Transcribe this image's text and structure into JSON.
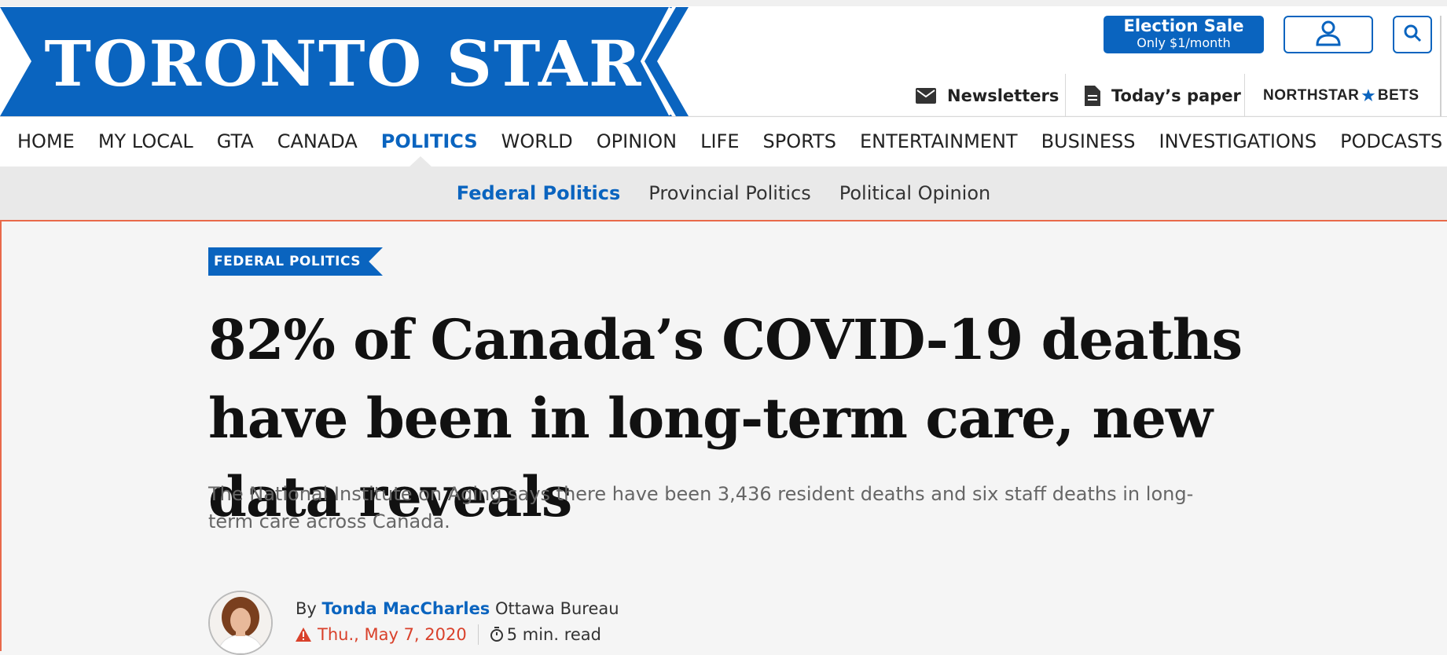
{
  "header": {
    "logo": "TORONTO STAR",
    "election_sale": {
      "title": "Election Sale",
      "subtitle": "Only $1/month"
    },
    "utility_links": [
      "Newsletters",
      "Today’s paper"
    ],
    "northstar": {
      "left": "NORTHSTAR",
      "right": "BETS"
    }
  },
  "main_nav": [
    "HOME",
    "MY LOCAL",
    "GTA",
    "CANADA",
    "POLITICS",
    "WORLD",
    "OPINION",
    "LIFE",
    "SPORTS",
    "ENTERTAINMENT",
    "BUSINESS",
    "INVESTIGATIONS",
    "PODCASTS"
  ],
  "main_nav_active": "POLITICS",
  "sub_nav": [
    "Federal Politics",
    "Provincial Politics",
    "Political Opinion"
  ],
  "sub_nav_active": "Federal Politics",
  "article": {
    "section_tag": "FEDERAL POLITICS",
    "headline": "82% of Canada’s COVID-19 deaths have been in long-term care, new data reveals",
    "dek": "The National Institute on Aging says there have been 3,436 resident deaths and six staff deaths in long-term care across Canada.",
    "byline_prefix": "By",
    "author": "Tonda MacCharles",
    "bureau": "Ottawa Bureau",
    "date": "Thu., May 7, 2020",
    "read_time": "5 min. read"
  },
  "colors": {
    "brand_blue": "#0a64bf",
    "accent_red": "#d9412b",
    "divider_orange": "#e9694a"
  },
  "icons": [
    "account-icon",
    "search-icon",
    "mail-icon",
    "document-icon",
    "warning-icon",
    "stopwatch-icon"
  ]
}
